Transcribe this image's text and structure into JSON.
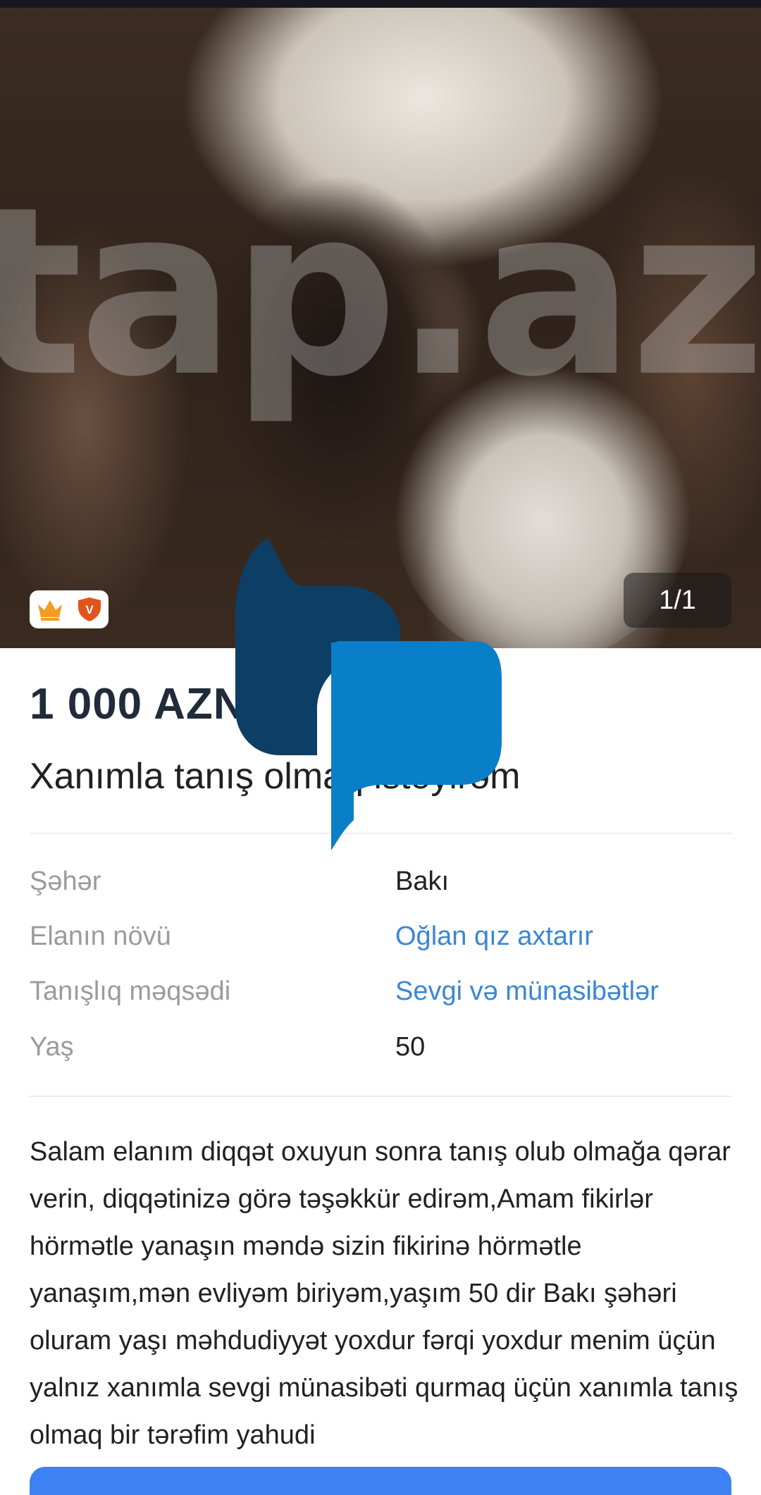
{
  "gallery": {
    "watermark": "tap.az",
    "counter": "1/1",
    "badges": [
      "crown-badge",
      "vip-badge"
    ],
    "badge_vip_letter": "V"
  },
  "listing": {
    "price": "1 000 AZN",
    "title": "Xanımla tanış olmaq istəyirəm"
  },
  "properties": [
    {
      "label": "Şəhər",
      "value": "Bakı",
      "link": false
    },
    {
      "label": "Elanın növü",
      "value": "Oğlan qız axtarır",
      "link": true
    },
    {
      "label": "Tanışlıq məqsədi",
      "value": "Sevgi və münasibətlər",
      "link": true
    },
    {
      "label": "Yaş",
      "value": "50",
      "link": false
    }
  ],
  "description": "Salam elanım diqqət oxuyun sonra tanış olub olmağa qərar verin, diqqətinizə görə təşəkkür edirəm,Amam fikirlər hörmətle yanaşın məndə sizin fikirinə hörmətle yanaşım,mən evliyəm biriyəm,yaşım 50 dir Bakı şəhəri oluram yaşı məhdudiyyət yoxdur fərqi yoxdur menim üçün yalnız xanımla sevgi münasibəti qurmaq üçün xanımla tanış olmaq bir tərəfim yahudi",
  "colors": {
    "link": "#3a86d6",
    "price": "#212c3a",
    "chat_dark": "#0d3f66",
    "chat_light": "#0a7fc9",
    "button": "#3d82f3",
    "crown": "#f59a23",
    "vip": "#e2541c"
  },
  "icons": {
    "chat": "chat-bubbles-icon",
    "crown": "crown-icon",
    "vip": "vip-shield-icon"
  }
}
